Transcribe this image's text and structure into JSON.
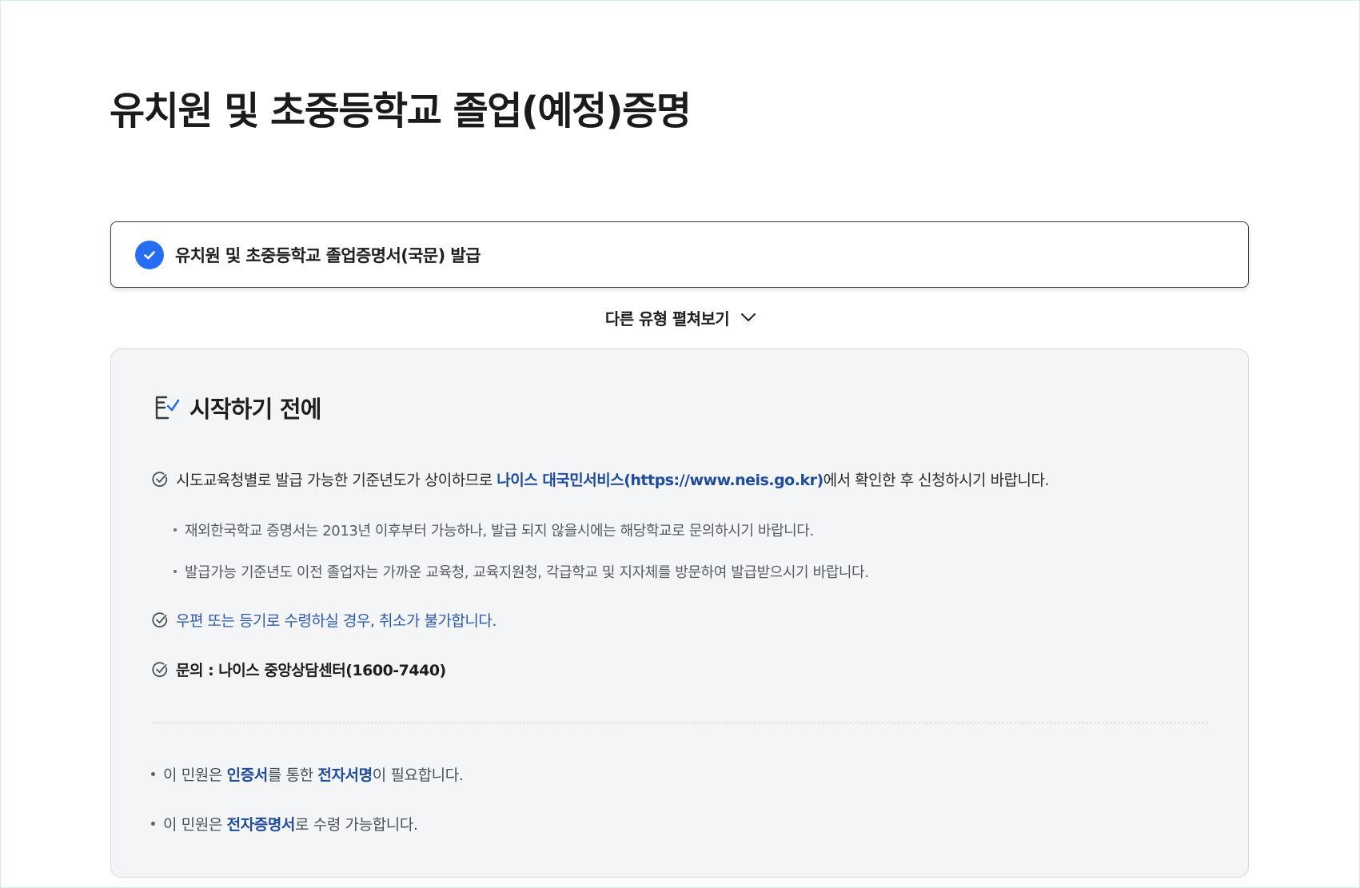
{
  "page": {
    "title": "유치원 및 초중등학교 졸업(예정)증명"
  },
  "selected_type": {
    "label": "유치원 및 초중등학교 졸업증명서(국문) 발급"
  },
  "expand_toggle": {
    "label": "다른 유형 펼쳐보기"
  },
  "before_start": {
    "heading": "시작하기 전에",
    "item1": {
      "text_before": "시도교육청별로 발급 가능한 기준년도가 상이하므로 ",
      "link": "나이스 대국민서비스(https://www.neis.go.kr)",
      "text_after": "에서 확인한 후 신청하시기 바랍니다."
    },
    "sub_items": [
      "재외한국학교 증명서는 2013년 이후부터 가능하나, 발급 되지 않을시에는 해당학교로 문의하시기 바랍니다.",
      "발급가능 기준년도 이전 졸업자는 가까운 교육청, 교육지원청, 각급학교 및 지자체를 방문하여 발급받으시기 바랍니다."
    ],
    "item2": "우편 또는 등기로 수령하실 경우, 취소가 불가합니다.",
    "item3": "문의 : 나이스 중앙상담센터(1600-7440)"
  },
  "notes": {
    "note1": {
      "prefix": "이 민원은 ",
      "hl1": "인증서",
      "mid": "를 통한 ",
      "hl2": "전자서명",
      "suffix": "이 필요합니다."
    },
    "note2": {
      "prefix": "이 민원은 ",
      "hl1": "전자증명서",
      "suffix": "로 수령 가능합니다."
    }
  },
  "icons": {
    "selected_check": "check-circle-icon",
    "expand": "chevron-down-icon",
    "heading": "checklist-icon",
    "item_check": "circle-check-icon"
  },
  "colors": {
    "accent": "#256ef4",
    "link": "#1f4c9b",
    "box_bg": "#f4f5f6"
  }
}
